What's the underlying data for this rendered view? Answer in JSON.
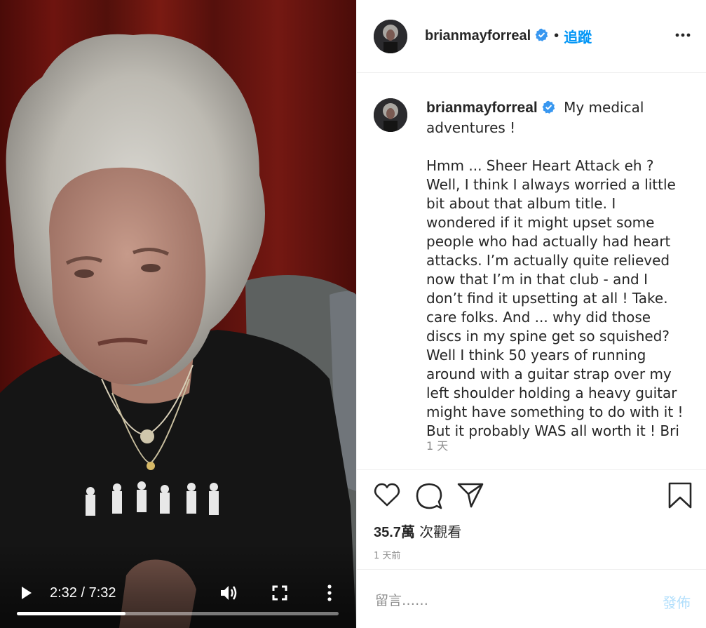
{
  "video": {
    "current_time": "2:32",
    "separator": " / ",
    "duration": "7:32",
    "progress": 0.337
  },
  "header": {
    "username": "brianmayforreal",
    "dot": "•",
    "follow_label": "追蹤"
  },
  "caption": {
    "username": "brianmayforreal",
    "text": "My medical adventures !\n\nHmm ... Sheer Heart Attack eh ? Well, I think I always worried a little bit about that album title. I wondered if it might upset some people who had actually had heart attacks. I’m actually quite relieved now that I’m in that club - and I don’t find it upsetting at all ! Take. care folks. And ... why did those discs in my spine get so squished? Well I think 50 years of running around with a guitar strap over my left shoulder holding a heavy guitar might have something to do with it ! But it probably WAS all worth it ! Bri",
    "time": "1 天"
  },
  "actions": {
    "views_count": "35.7萬",
    "views_label": " 次觀看",
    "post_age": "1 天前"
  },
  "comment": {
    "placeholder": "留言……",
    "post_label": "發佈"
  },
  "colors": {
    "accent": "#0095f6",
    "verified": "#3897f0",
    "post_disabled": "#b2dffc",
    "secondary_text": "#8e8e8e"
  },
  "icons": {
    "play": "play-icon",
    "volume": "volume-icon",
    "fullscreen": "fullscreen-icon",
    "video_more": "more-vertical-icon",
    "header_more": "more-horizontal-icon",
    "verified": "verified-badge-icon",
    "like": "heart-icon",
    "comment": "comment-icon",
    "share": "paper-plane-icon",
    "save": "bookmark-icon"
  }
}
